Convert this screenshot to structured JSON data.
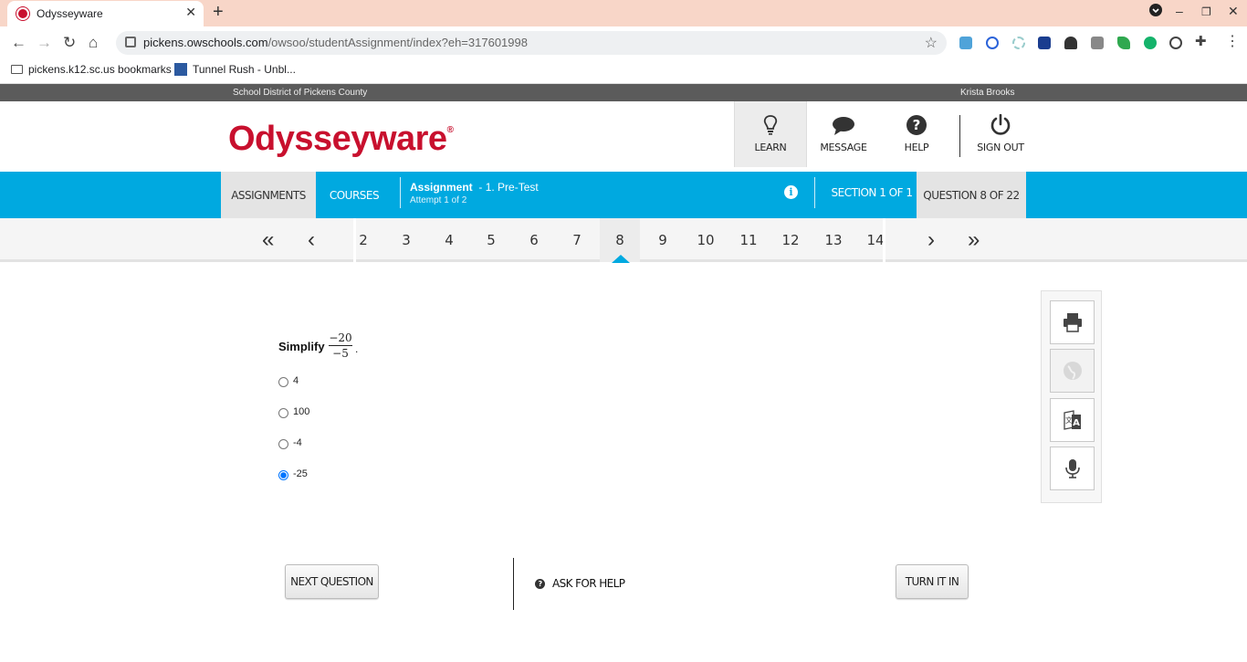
{
  "browser": {
    "tab_title": "Odysseyware",
    "url_host": "pickens.owschools.com",
    "url_path": "/owsoo/studentAssignment/index?eh=317601998",
    "bookmarks": [
      "pickens.k12.sc.us bookmarks",
      "Tunnel Rush - Unbl..."
    ]
  },
  "site": {
    "district": "School District of Pickens County",
    "user": "Krista Brooks",
    "logo": "Odysseyware",
    "nav": {
      "learn": "LEARN",
      "message": "MESSAGE",
      "help": "HELP",
      "signout": "SIGN OUT"
    }
  },
  "assignment_bar": {
    "assignments": "ASSIGNMENTS",
    "courses": "COURSES",
    "assignment_label": "Assignment",
    "assignment_name": "- 1. Pre-Test",
    "attempt": "Attempt 1 of 2",
    "section": "SECTION 1 OF 1",
    "question": "QUESTION 8 OF 22"
  },
  "pager": {
    "pages": [
      "2",
      "3",
      "4",
      "5",
      "6",
      "7",
      "8",
      "9",
      "10",
      "11",
      "12",
      "13",
      "14"
    ],
    "current": "8"
  },
  "question": {
    "prompt": "Simplify",
    "numerator": "−20",
    "denominator": "−5",
    "trailing": ".",
    "options": [
      "4",
      "100",
      "-4",
      "-25"
    ],
    "selected_index": 3
  },
  "actions": {
    "next": "NEXT QUESTION",
    "ask_help": "ASK FOR HELP",
    "turn_in": "TURN IT IN"
  },
  "colors": {
    "brand_red": "#c8102e",
    "bar_blue": "#00a9e0"
  }
}
